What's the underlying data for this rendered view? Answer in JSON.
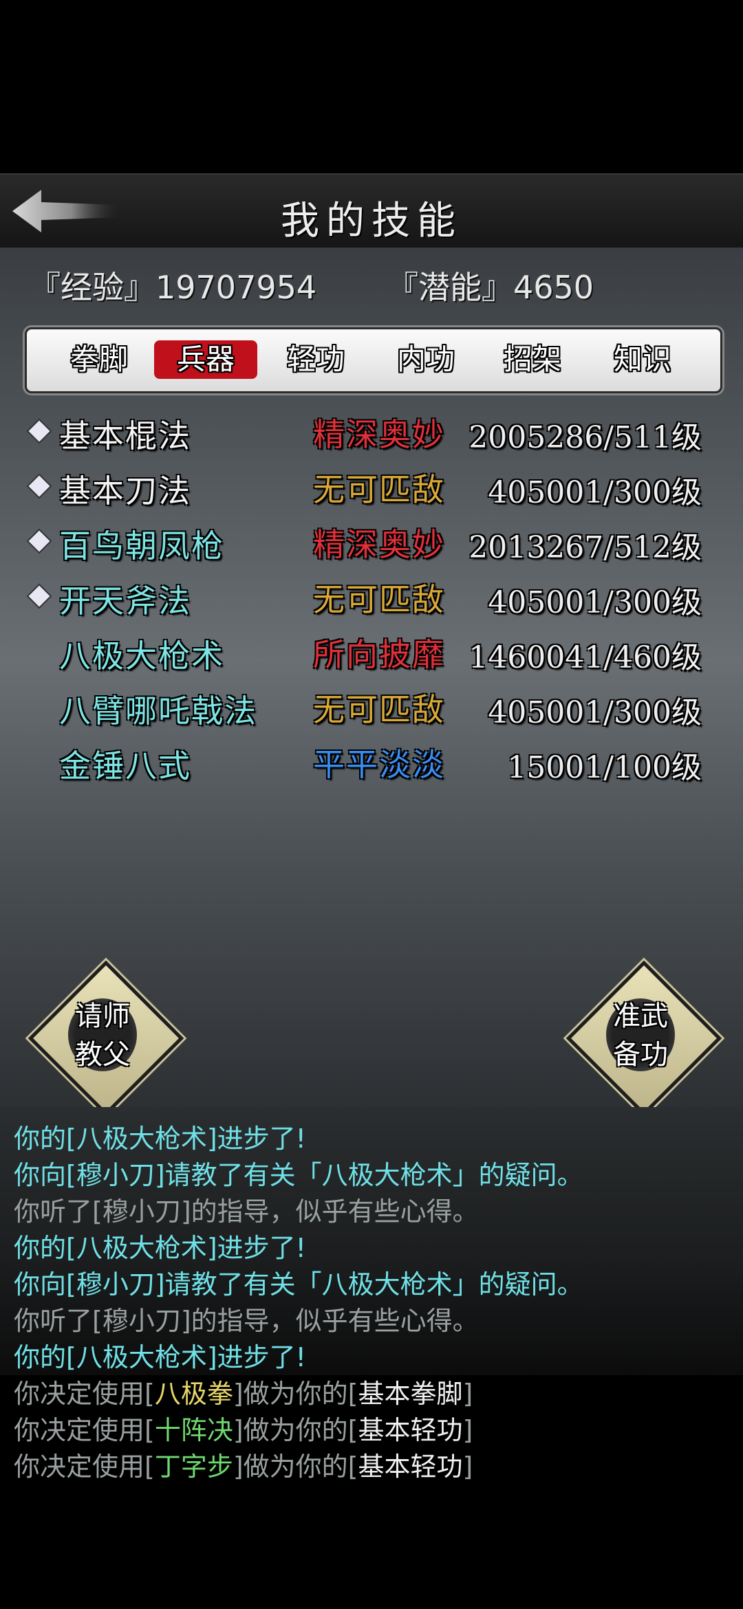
{
  "header": {
    "title": "我的技能"
  },
  "stats": {
    "exp_label": "『经验』",
    "exp_value": "19707954",
    "pot_label": "『潜能』",
    "pot_value": "4650"
  },
  "tabs": [
    {
      "label": "拳脚",
      "active": false
    },
    {
      "label": "兵器",
      "active": true
    },
    {
      "label": "轻功",
      "active": false
    },
    {
      "label": "内功",
      "active": false
    },
    {
      "label": "招架",
      "active": false
    },
    {
      "label": "知识",
      "active": false
    }
  ],
  "skills": [
    {
      "name": "基本棍法",
      "level": "精深奥妙",
      "value": "2005286/511级"
    },
    {
      "name": "基本刀法",
      "level": "无可匹敌",
      "value": "405001/300级"
    },
    {
      "name": "百鸟朝凤枪",
      "level": "精深奥妙",
      "value": "2013267/512级"
    },
    {
      "name": "开天斧法",
      "level": "无可匹敌",
      "value": "405001/300级"
    },
    {
      "name": "八极大枪术",
      "level": "所向披靡",
      "value": "1460041/460级"
    },
    {
      "name": "八臂哪吒戟法",
      "level": "无可匹敌",
      "value": "405001/300级"
    },
    {
      "name": "金锤八式",
      "level": "平平淡淡",
      "value": "15001/100级"
    }
  ],
  "colors": {
    "red": "#e0303a",
    "gold": "#d8a838",
    "blue": "#3a8cf0"
  },
  "buttons": {
    "left_line1": "请师",
    "left_line2": "教父",
    "right_line1": "准武",
    "right_line2": "备功"
  },
  "log": {
    "l1": "你的[八极大枪术]进步了!",
    "l2": "你向[穆小刀]请教了有关「八极大枪术」的疑问。",
    "l3": "你听了[穆小刀]的指导，似乎有些心得。",
    "l4": "你的[八极大枪术]进步了!",
    "l5": "你向[穆小刀]请教了有关「八极大枪术」的疑问。",
    "l6": "你听了[穆小刀]的指导，似乎有些心得。",
    "l7": "你的[八极大枪术]进步了!",
    "l8_a": "你决定使用[",
    "l8_b": "八极拳",
    "l8_c": "]做为你的[",
    "l8_d": "基本拳脚",
    "l8_e": "]",
    "l9_a": "你决定使用[",
    "l9_b": "十阵决",
    "l9_c": "]做为你的[",
    "l9_d": "基本轻功",
    "l9_e": "]",
    "l10_a": "你决定使用[",
    "l10_b": "丁字步",
    "l10_c": "]做为你的[",
    "l10_d": "基本轻功",
    "l10_e": "]"
  }
}
